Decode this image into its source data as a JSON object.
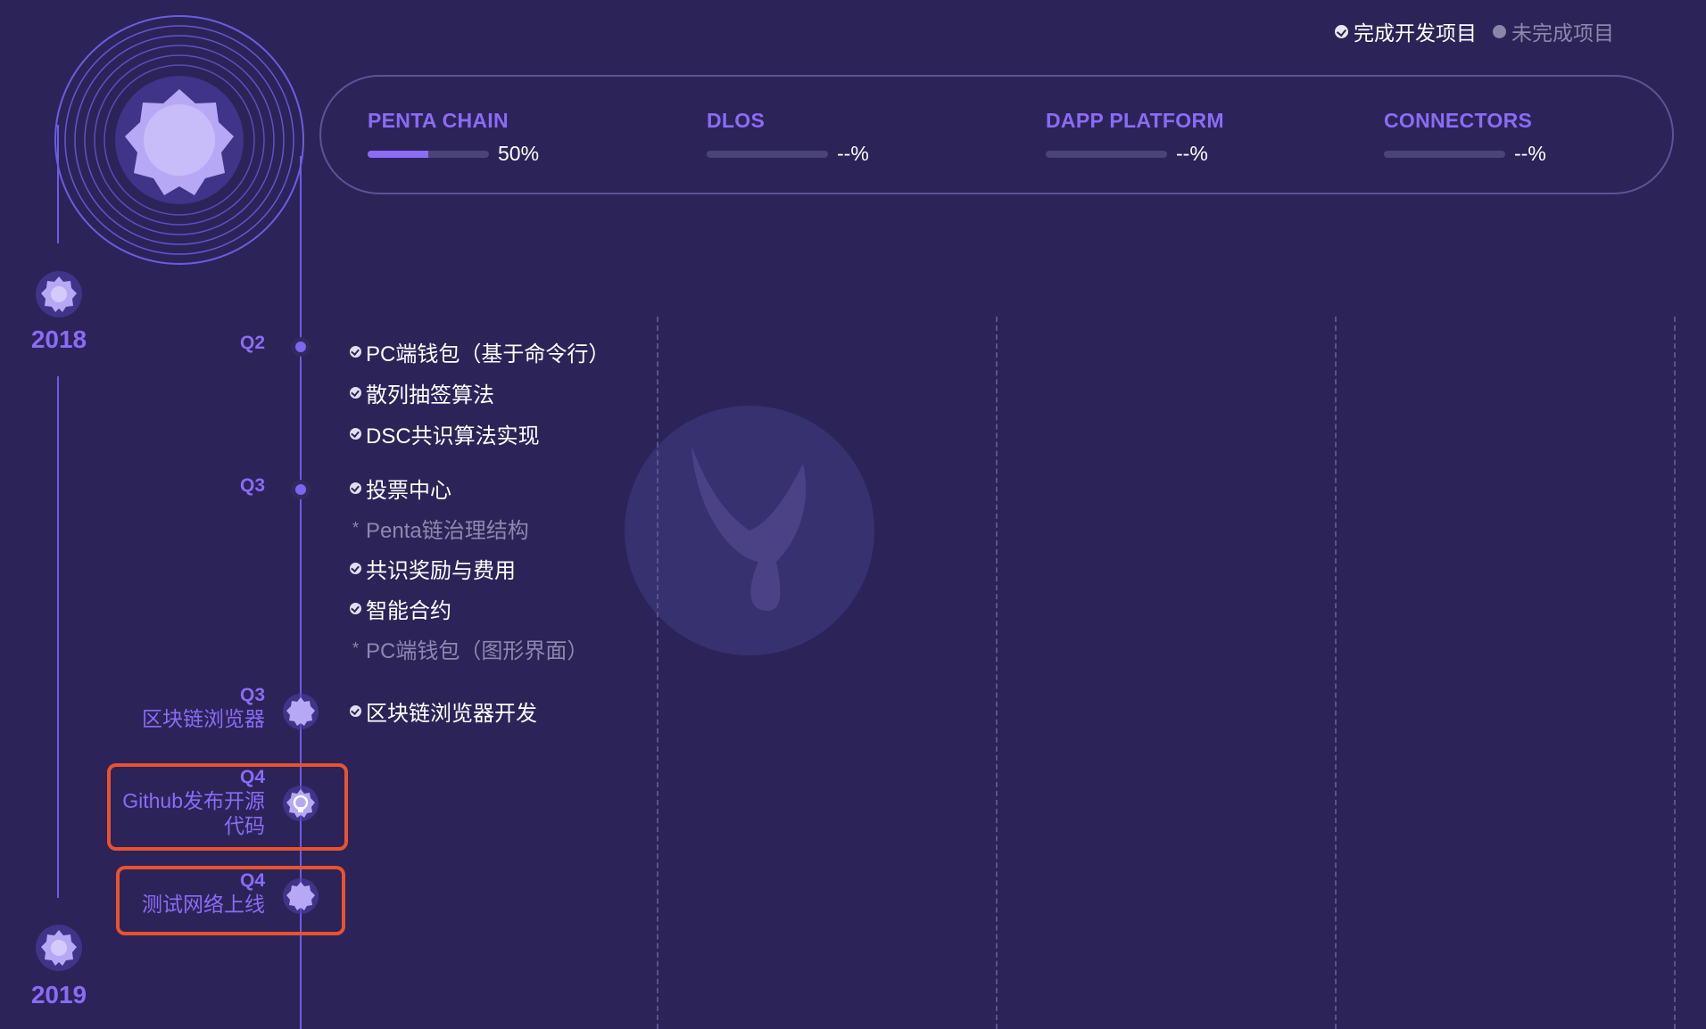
{
  "legend": {
    "completed_label": "完成开发项目",
    "incomplete_label": "未完成项目"
  },
  "progress": [
    {
      "title": "PENTA CHAIN",
      "value_text": "50%",
      "fraction": 0.5
    },
    {
      "title": "DLOS",
      "value_text": "--%",
      "fraction": 0
    },
    {
      "title": "DAPP PLATFORM",
      "value_text": "--%",
      "fraction": 0
    },
    {
      "title": "CONNECTORS",
      "value_text": "--%",
      "fraction": 0
    }
  ],
  "years": [
    "2018",
    "2019"
  ],
  "timeline": {
    "q2_2018": {
      "label": "Q2",
      "items": [
        {
          "text": "PC端钱包（基于命令行）",
          "done": true
        },
        {
          "text": "散列抽签算法",
          "done": true
        },
        {
          "text": "DSC共识算法实现",
          "done": true
        }
      ]
    },
    "q3_2018": {
      "label": "Q3",
      "items": [
        {
          "text": "投票中心",
          "done": true
        },
        {
          "text": "Penta链治理结构",
          "done": false
        },
        {
          "text": "共识奖励与费用",
          "done": true
        },
        {
          "text": "智能合约",
          "done": true
        },
        {
          "text": "PC端钱包（图形界面）",
          "done": false
        }
      ]
    },
    "milestone_explorer": {
      "label": "Q3",
      "note": "区块链浏览器",
      "items": [
        {
          "text": "区块链浏览器开发",
          "done": true
        }
      ]
    },
    "milestone_github": {
      "label": "Q4",
      "note_line1": "Github发布开源",
      "note_line2": "代码"
    },
    "milestone_testnet": {
      "label": "Q4",
      "note": "测试网络上线"
    }
  },
  "colors": {
    "background": "#2c2358",
    "accent": "#8a6cf5",
    "highlight_border": "#e8532d"
  }
}
